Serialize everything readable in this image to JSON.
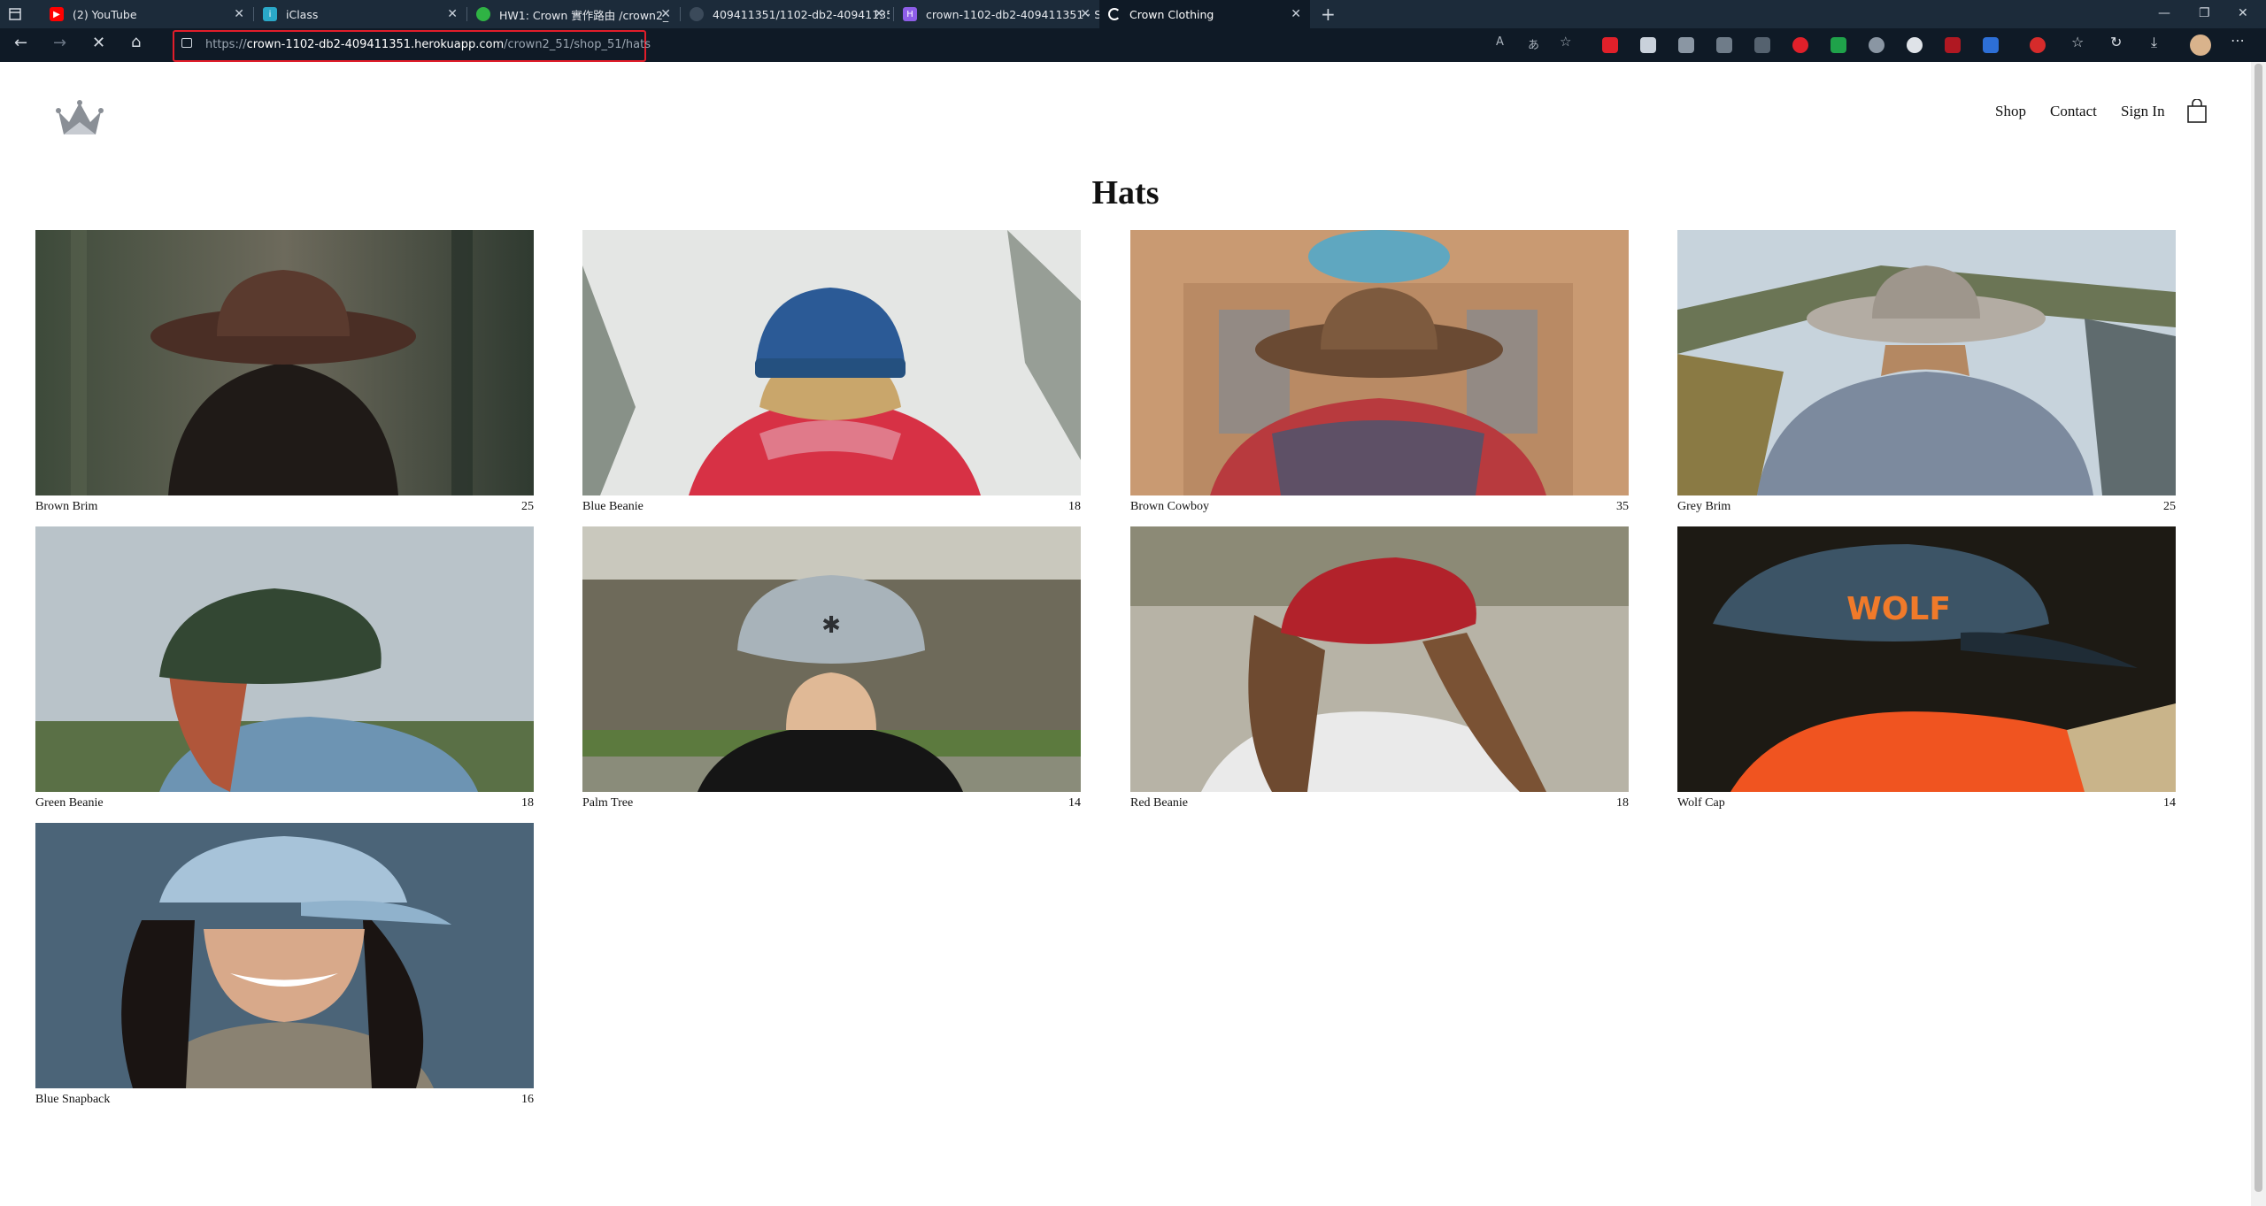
{
  "browser": {
    "tabs": [
      {
        "title": "(2) YouTube",
        "icon": "youtube-icon",
        "color": "#ff0000"
      },
      {
        "title": "iClass",
        "icon": "iclass-icon",
        "color": "#2aa8c8"
      },
      {
        "title": "HW1: Crown 實作路由 /crown2_",
        "icon": "hw-icon",
        "color": "#2fb344"
      },
      {
        "title": "409411351/1102-db2-40941135",
        "icon": "github-icon",
        "color": "#9aa5b1"
      },
      {
        "title": "crown-1102-db2-409411351 · S",
        "icon": "heroku-icon",
        "color": "#8e5ee8"
      },
      {
        "title": "Crown Clothing",
        "icon": "loading-icon",
        "color": "#ffffff"
      }
    ],
    "url_prefix": "https://",
    "url_host": "crown-1102-db2-409411351.herokuapp.com",
    "url_path": "/crown2_51/shop_51/hats"
  },
  "header": {
    "nav": [
      "Shop",
      "Contact",
      "Sign In"
    ]
  },
  "page": {
    "title": "Hats",
    "items": [
      {
        "name": "Brown Brim",
        "price": "25"
      },
      {
        "name": "Blue Beanie",
        "price": "18"
      },
      {
        "name": "Brown Cowboy",
        "price": "35"
      },
      {
        "name": "Grey Brim",
        "price": "25"
      },
      {
        "name": "Green Beanie",
        "price": "18"
      },
      {
        "name": "Palm Tree",
        "price": "14"
      },
      {
        "name": "Red Beanie",
        "price": "18"
      },
      {
        "name": "Wolf Cap",
        "price": "14"
      },
      {
        "name": "Blue Snapback",
        "price": "16"
      }
    ]
  }
}
